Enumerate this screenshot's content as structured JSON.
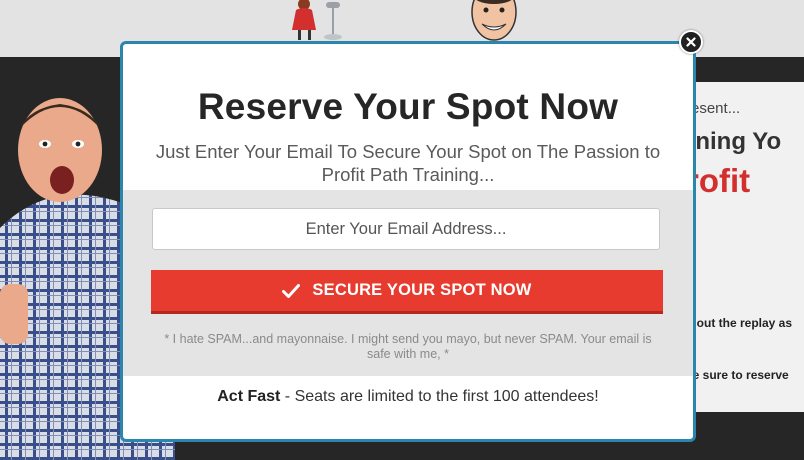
{
  "background": {
    "card_lines": [
      "resent...",
      "rning Yo",
      "rofit",
      "d out the replay as",
      "ke sure to reserve"
    ]
  },
  "modal": {
    "title": "Reserve Your Spot Now",
    "subtitle": "Just Enter Your Email To Secure Your Spot on The Passion to Profit Path Training...",
    "email_placeholder": "Enter Your Email Address...",
    "button_label": "SECURE YOUR SPOT NOW",
    "button_icon": "check-icon",
    "disclaimer": "* I hate SPAM...and mayonnaise. I might send you mayo, but never SPAM. Your email is safe with me, *",
    "footer_bold": "Act Fast",
    "footer_rest": " - Seats are limited to the first 100 attendees!",
    "close_icon": "close-icon"
  },
  "colors": {
    "border_accent": "#2a86ad",
    "button": "#e63b2e",
    "gray_band": "#e4e4e4",
    "headline_red": "#d32f2f"
  }
}
